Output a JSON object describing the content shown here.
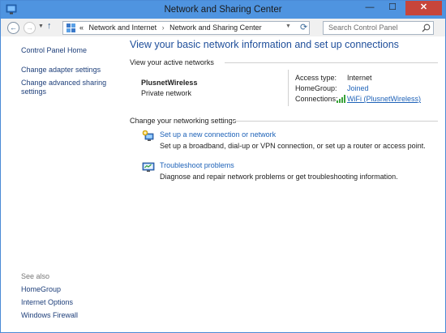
{
  "window": {
    "title": "Network and Sharing Center",
    "minimize": "—",
    "maximize": "☐",
    "close": "✕"
  },
  "nav": {
    "back": "←",
    "forward": "→",
    "up": "↑",
    "breadcrumb_prefix": "«",
    "breadcrumb": [
      "Network and Internet",
      "Network and Sharing Center"
    ],
    "separator": "›",
    "search_placeholder": "Search Control Panel"
  },
  "sidebar": {
    "items": [
      {
        "label": "Control Panel Home"
      },
      {
        "label": "Change adapter settings"
      },
      {
        "label": "Change advanced sharing"
      },
      {
        "label": "settings"
      }
    ],
    "see_also_label": "See also",
    "see_also": [
      {
        "label": "HomeGroup"
      },
      {
        "label": "Internet Options"
      },
      {
        "label": "Windows Firewall"
      }
    ]
  },
  "main": {
    "heading": "View your basic network information and set up connections",
    "active_section": "View your active networks",
    "network": {
      "name": "PlusnetWireless",
      "type": "Private network",
      "access_type_label": "Access type:",
      "access_type_value": "Internet",
      "homegroup_label": "HomeGroup:",
      "homegroup_value": "Joined",
      "connections_label": "Connections:",
      "connections_value": "WiFi (PlusnetWireless)"
    },
    "settings_section": "Change your networking settings",
    "tasks": [
      {
        "link": "Set up a new connection or network",
        "description": "Set up a broadband, dial-up or VPN connection, or set up a router or access point."
      },
      {
        "link": "Troubleshoot problems",
        "description": "Diagnose and repair network problems or get troubleshooting information."
      }
    ]
  },
  "colors": {
    "titlebar": "#4f94e0",
    "link": "#1e62b8",
    "heading": "#1e4e9a",
    "close": "#c7453b"
  }
}
